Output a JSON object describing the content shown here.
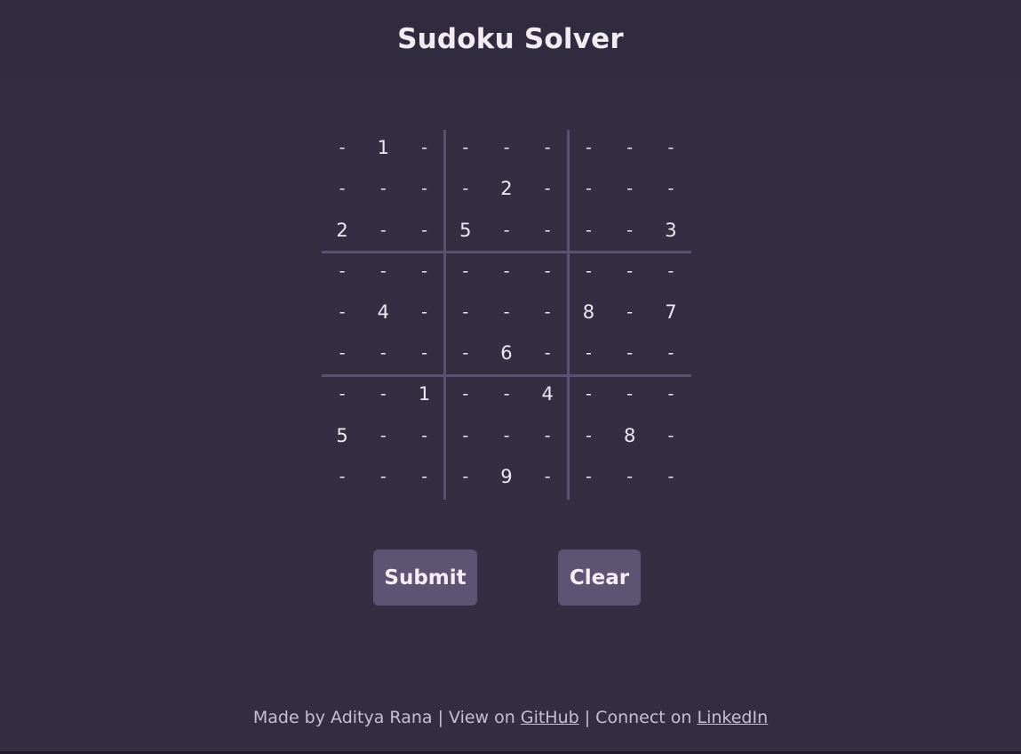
{
  "header": {
    "title": "Sudoku Solver"
  },
  "board": {
    "empty_symbol": "-",
    "rows": [
      [
        "-",
        "1",
        "-",
        "-",
        "-",
        "-",
        "-",
        "-",
        "-"
      ],
      [
        "-",
        "-",
        "-",
        "-",
        "2",
        "-",
        "-",
        "-",
        "-"
      ],
      [
        "2",
        "-",
        "-",
        "5",
        "-",
        "-",
        "-",
        "-",
        "3"
      ],
      [
        "-",
        "-",
        "-",
        "-",
        "-",
        "-",
        "-",
        "-",
        "-"
      ],
      [
        "-",
        "4",
        "-",
        "-",
        "-",
        "-",
        "8",
        "-",
        "7"
      ],
      [
        "-",
        "-",
        "-",
        "-",
        "6",
        "-",
        "-",
        "-",
        "-"
      ],
      [
        "-",
        "-",
        "1",
        "-",
        "-",
        "4",
        "-",
        "-",
        "-"
      ],
      [
        "5",
        "-",
        "-",
        "-",
        "-",
        "-",
        "-",
        "8",
        "-"
      ],
      [
        "-",
        "-",
        "-",
        "-",
        "9",
        "-",
        "-",
        "-",
        "-"
      ]
    ]
  },
  "actions": {
    "submit_label": "Submit",
    "clear_label": "Clear"
  },
  "footer": {
    "made_by": "Made by Aditya Rana",
    "separator_1": " | View on ",
    "github_label": "GitHub",
    "separator_2": " | Connect on ",
    "linkedin_label": "LinkedIn"
  },
  "colors": {
    "background": "#342e43",
    "header_background": "#312b3f",
    "grid_line": "#5b5272",
    "button_background": "#5d5373",
    "text": "#f0e8f0"
  }
}
